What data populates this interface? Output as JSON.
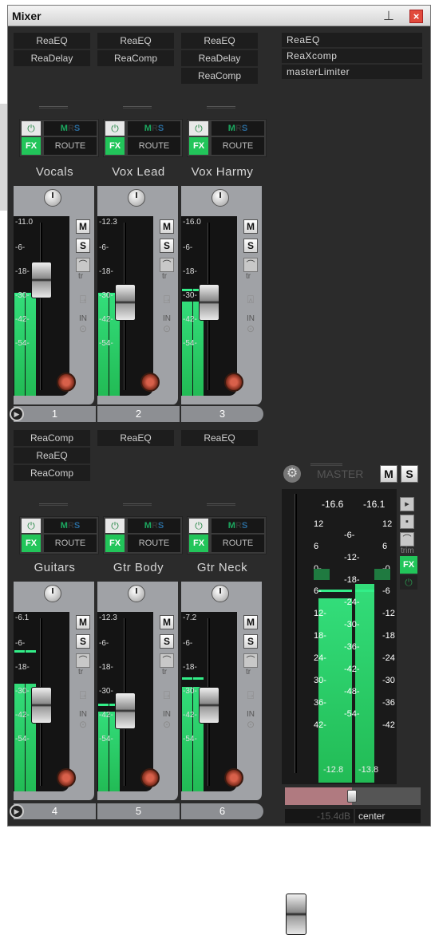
{
  "window": {
    "title": "Mixer"
  },
  "top_row": {
    "fx": [
      [
        "ReaEQ",
        "ReaDelay"
      ],
      [
        "ReaEQ",
        "ReaComp"
      ],
      [
        "ReaEQ",
        "ReaDelay",
        "ReaComp"
      ]
    ],
    "tracks": [
      {
        "name": "Vocals",
        "number": "1",
        "vol_readout": "-11.0",
        "level": 0.58,
        "peak": 0.58,
        "fader": 0.77,
        "auto_icon": "ghost",
        "arm_in": "IN"
      },
      {
        "name": "Vox Lead",
        "number": "2",
        "vol_readout": "-12.3",
        "level": 0.58,
        "peak": 0.58,
        "fader": 0.64,
        "auto_icon": "ghost",
        "arm_in": "IN"
      },
      {
        "name": "Vox Harmy",
        "number": "3",
        "vol_readout": "-16.0",
        "level": 0.54,
        "peak": 0.6,
        "fader": 0.64,
        "auto_icon": "A",
        "arm_in": "IN"
      }
    ]
  },
  "bottom_row": {
    "fx": [
      [
        "ReaComp",
        "ReaEQ",
        "ReaComp"
      ],
      [
        "ReaEQ"
      ],
      [
        "ReaEQ"
      ]
    ],
    "tracks": [
      {
        "name": "Guitars",
        "number": "4",
        "vol_readout": "-6.1",
        "level": 0.62,
        "peak": 0.8,
        "fader": 0.6,
        "auto_icon": "ghost",
        "arm_in": "IN"
      },
      {
        "name": "Gtr Body",
        "number": "5",
        "vol_readout": "-12.3",
        "level": 0.46,
        "peak": 0.49,
        "fader": 0.57,
        "auto_icon": "ghost",
        "arm_in": "IN"
      },
      {
        "name": "Gtr Neck",
        "number": "6",
        "vol_readout": "-7.2",
        "level": 0.6,
        "peak": 0.64,
        "fader": 0.6,
        "auto_icon": "ghost",
        "arm_in": "IN"
      }
    ]
  },
  "master": {
    "fx": [
      "ReaEQ",
      "ReaXcomp",
      "masterLimiter"
    ],
    "label": "MASTER",
    "mute": "M",
    "solo": "S",
    "peaks": [
      "-16.6",
      "-16.1"
    ],
    "scale_left": [
      "12",
      "6",
      "0-",
      "6-",
      "12-",
      "18-",
      "24-",
      "30-",
      "36-",
      "42-"
    ],
    "scale_right": [
      "12",
      "6",
      "-0",
      "-6",
      "-12",
      "-18",
      "-24",
      "-30",
      "-36",
      "-42"
    ],
    "scale_mid": [
      "-6-",
      "-12-",
      "-18-",
      "-24-",
      "-30-",
      "-36-",
      "-42-",
      "-48-",
      "-54-"
    ],
    "bottom_vals": [
      "-12.8",
      "-13.8"
    ],
    "vol_readout": "-15.4dB",
    "pan": "center",
    "trim": "trim",
    "fx_label": "FX",
    "level_l": 0.77,
    "level_r": 0.83
  },
  "strip_labels": {
    "power": "⏻",
    "fx": "FX",
    "m": "M",
    "r": "R",
    "s": "S",
    "route": "ROUTE",
    "mute": "M",
    "solo": "S",
    "trim": "tr",
    "scale": [
      "-6-",
      "-18-",
      "-30-",
      "-42-",
      "-54-"
    ]
  }
}
